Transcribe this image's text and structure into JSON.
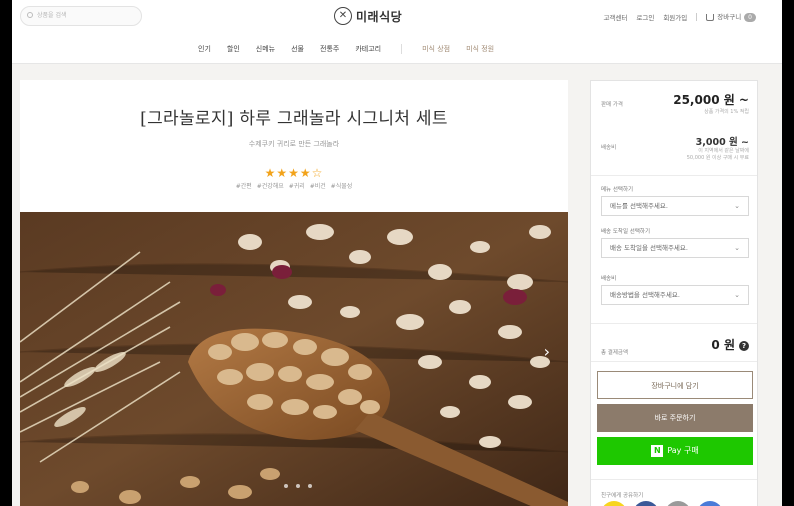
{
  "header": {
    "search_placeholder": "상품을 검색",
    "logo": "미래식당",
    "util": [
      "고객센터",
      "로그인",
      "회원가입"
    ],
    "cart_label": "장바구니",
    "cart_count": "0"
  },
  "nav": {
    "items": [
      "인기",
      "할인",
      "신메뉴",
      "선물",
      "전통주",
      "카테고리"
    ],
    "sub_items": [
      "미식 상점",
      "미식 정원"
    ]
  },
  "product": {
    "title": "[그라놀로지] 하루 그래놀라 시그니처 세트",
    "subtitle": "수제쿠키 귀리로 만든 그래놀라",
    "stars": "★★★★☆",
    "rating": 4,
    "tags": "#간편 #건강해요 #귀리 #비건 #식물성"
  },
  "panel": {
    "price_label": "판매 가격",
    "price": "25,000 원 ~",
    "price_note": "상품 가격의 1% 적립",
    "ship_label": "배송비",
    "ship_value": "3,000 원 ~",
    "ship_note_1": "이 지역에서 같은 날짜에",
    "ship_note_2": "50,000 원 이상 구매 시 무료",
    "menu_label": "메뉴 선택하기",
    "menu_placeholder": "메뉴를 선택해주세요.",
    "date_label": "배송 도착일 선택하기",
    "date_placeholder": "배송 도착일을 선택해주세요.",
    "method_label": "배송비",
    "method_placeholder": "배송방법을 선택해주세요.",
    "total_label": "총 결제금액",
    "total_value": "0 원",
    "btn_cart": "장바구니에 담기",
    "btn_buy": "바로 주문하기",
    "btn_npay": "Pay 구매",
    "npay_badge": "N",
    "share_label": "친구에게 공유하기"
  },
  "colors": {
    "accent": "#8c7b6b",
    "npay": "#1ec800",
    "star": "#f2a31b"
  }
}
